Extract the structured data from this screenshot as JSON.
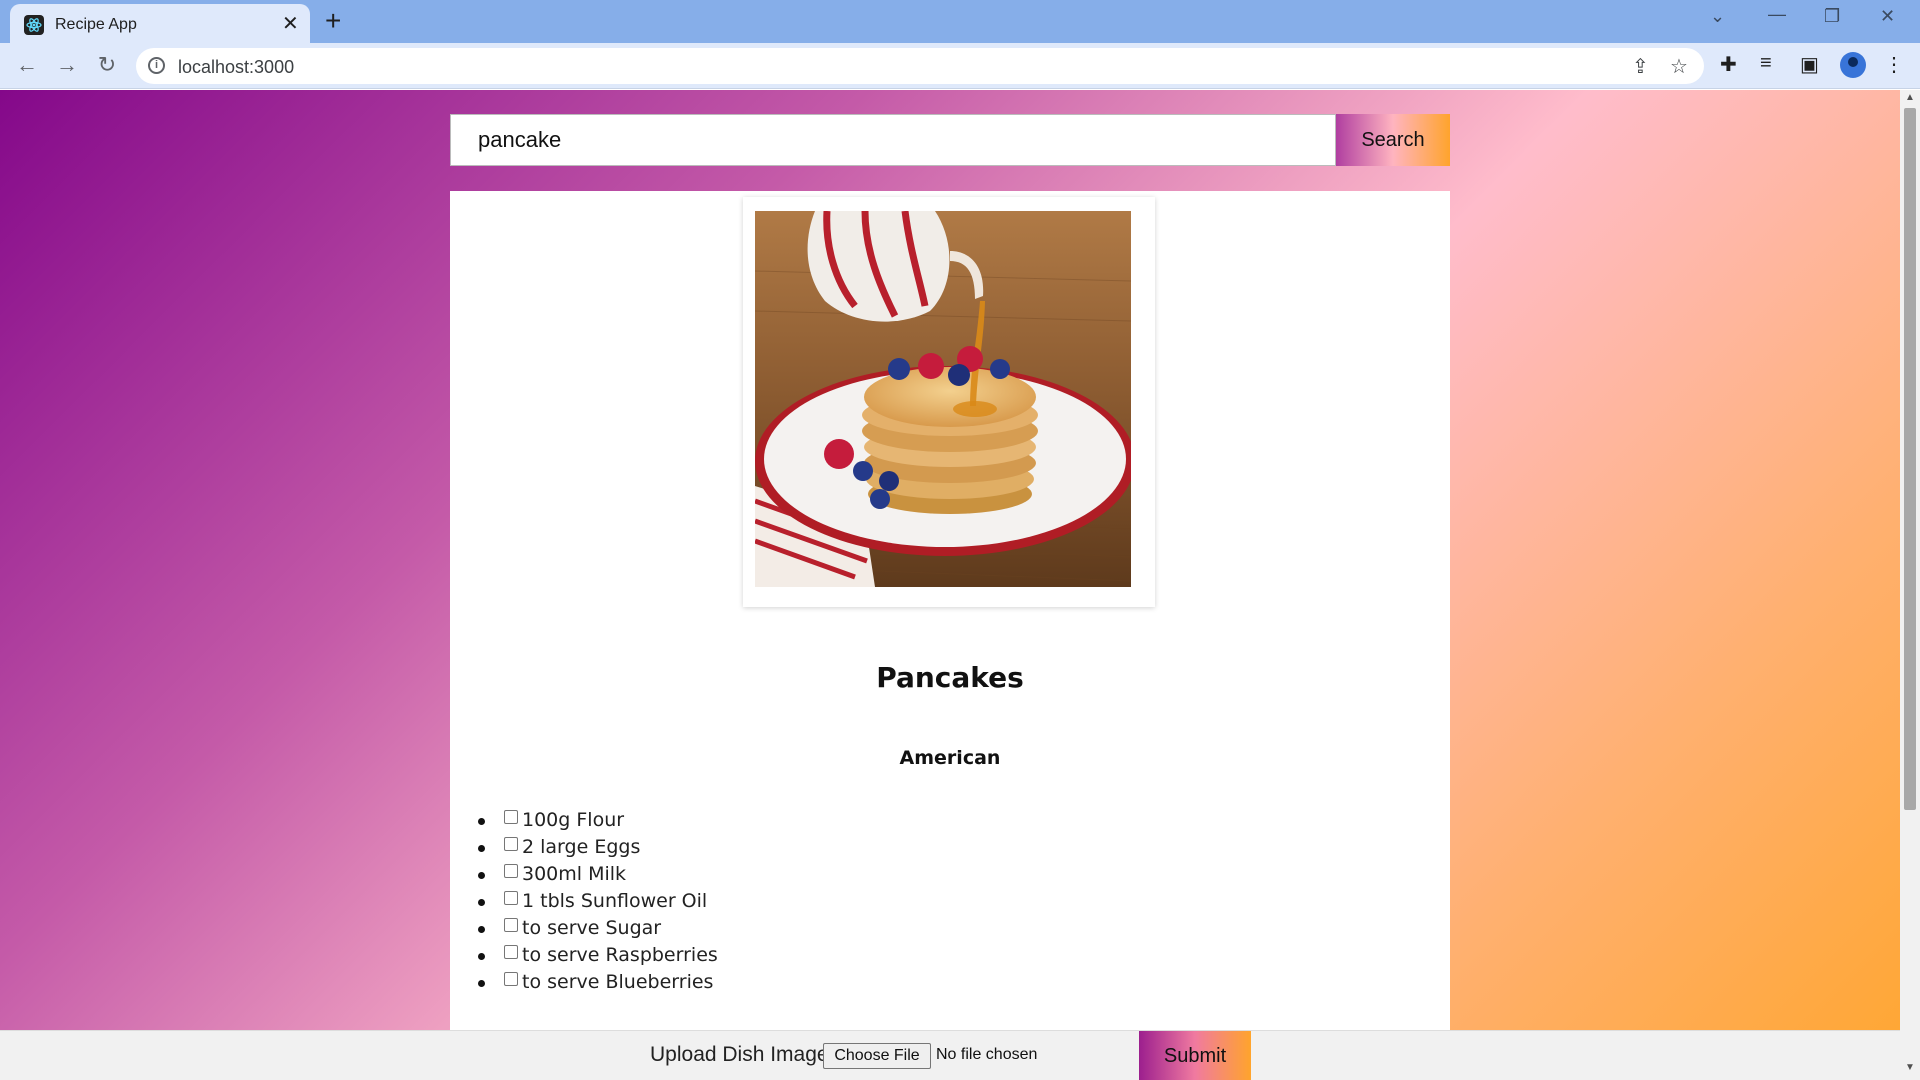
{
  "browser": {
    "tab_title": "Recipe App",
    "url": "localhost:3000",
    "icons": [
      "react-icon",
      "close-icon",
      "plus-icon",
      "chevron-down-icon",
      "minimize-icon",
      "restore-icon",
      "close-window-icon",
      "back-icon",
      "forward-icon",
      "reload-icon",
      "info-icon",
      "share-icon",
      "star-icon",
      "extensions-icon",
      "media-icon",
      "sidepanel-icon",
      "profile-icon",
      "menu-icon"
    ]
  },
  "search": {
    "value": "pancake",
    "button_label": "Search"
  },
  "recipe": {
    "title": "Pancakes",
    "cuisine": "American",
    "ingredients": [
      "100g Flour",
      "2 large Eggs",
      "300ml Milk",
      "1 tbls Sunflower Oil",
      "to serve Sugar",
      "to serve Raspberries",
      "to serve Blueberries"
    ]
  },
  "upload": {
    "label": "Upload Dish Image:",
    "file_button": "Choose File",
    "file_status": "No file chosen",
    "submit_label": "Submit"
  },
  "colors": {
    "tabstrip": "#86aee9",
    "toolbar": "#dfe9fb",
    "gradient_start": "#84088a",
    "gradient_end": "#ffa630"
  }
}
